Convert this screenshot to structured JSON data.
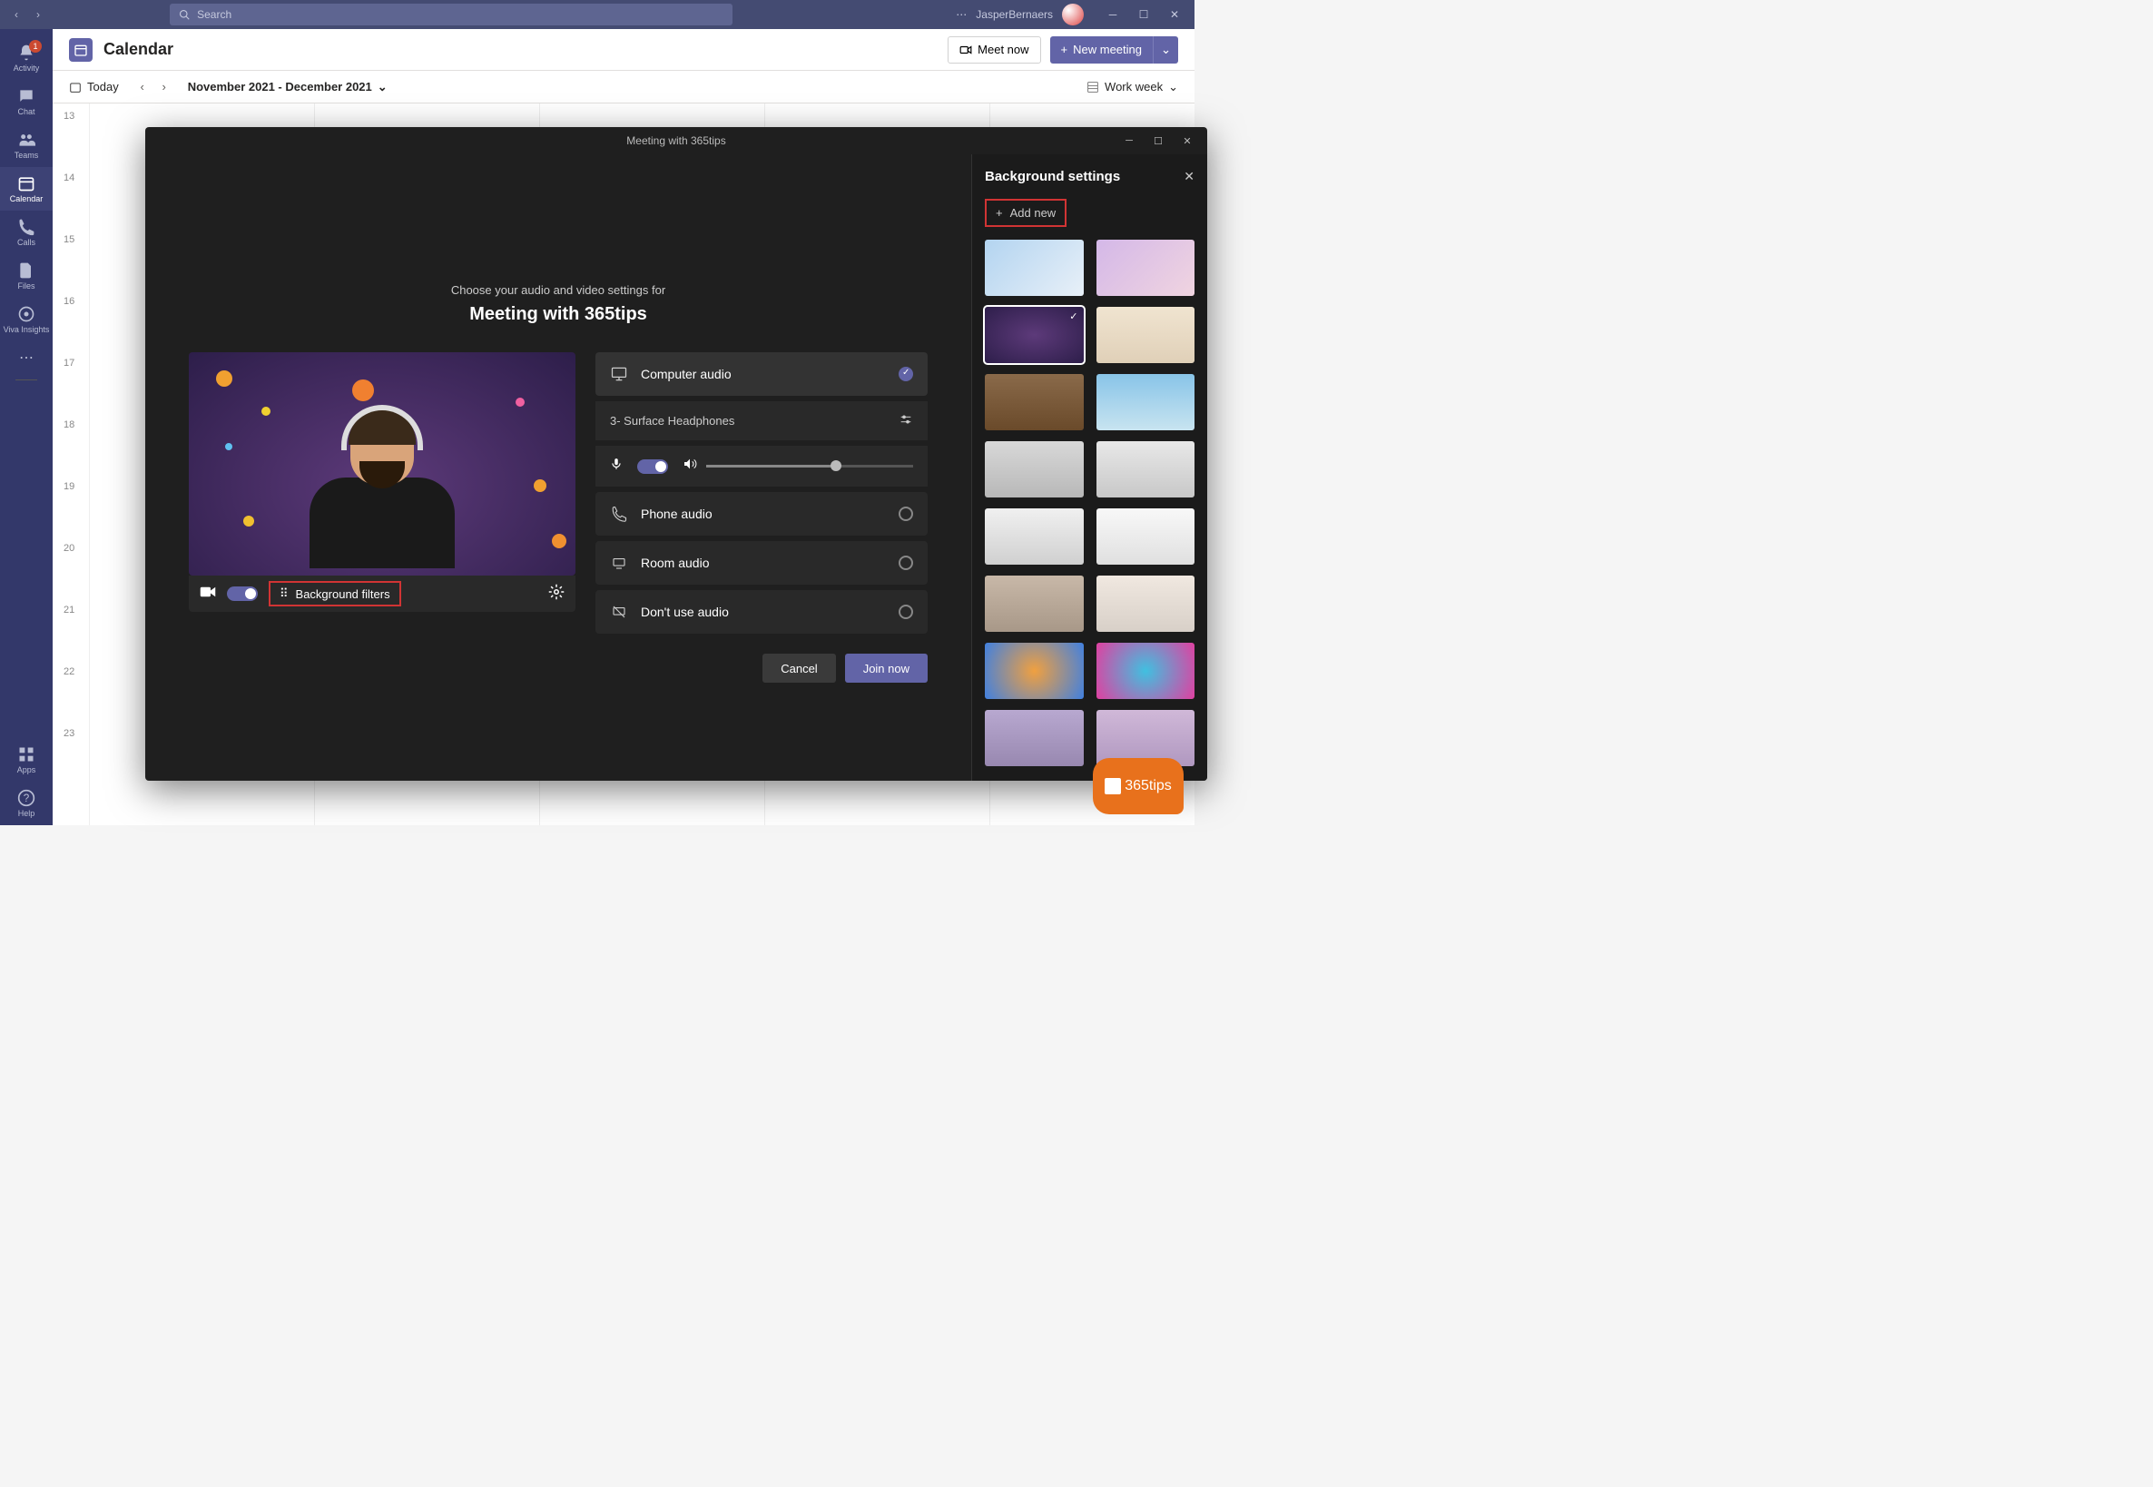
{
  "titlebar": {
    "search_placeholder": "Search",
    "username": "JasperBernaers"
  },
  "rail": {
    "items": [
      {
        "label": "Activity",
        "badge": "1"
      },
      {
        "label": "Chat"
      },
      {
        "label": "Teams"
      },
      {
        "label": "Calendar",
        "active": true
      },
      {
        "label": "Calls"
      },
      {
        "label": "Files"
      },
      {
        "label": "Viva Insights"
      }
    ],
    "apps_label": "Apps",
    "help_label": "Help"
  },
  "calendar": {
    "title": "Calendar",
    "meet_now": "Meet now",
    "new_meeting": "New meeting",
    "today": "Today",
    "range": "November 2021 - December 2021",
    "view": "Work week",
    "hours": [
      "13",
      "14",
      "15",
      "16",
      "17",
      "18",
      "19",
      "20",
      "21",
      "22",
      "23"
    ]
  },
  "modal": {
    "window_title": "Meeting with 365tips",
    "choose_text": "Choose your audio and video settings for",
    "meeting_name": "Meeting with 365tips",
    "bg_filters": "Background filters",
    "audio": {
      "computer": "Computer audio",
      "device": "3- Surface Headphones",
      "phone": "Phone audio",
      "room": "Room audio",
      "none": "Don't use audio"
    },
    "cancel": "Cancel",
    "join": "Join now"
  },
  "bg_panel": {
    "title": "Background settings",
    "add_new": "Add new",
    "thumbs": [
      {
        "bg": "linear-gradient(135deg,#b3d4f0,#e8f0f8)"
      },
      {
        "bg": "linear-gradient(135deg,#d4b8e8,#f0d4e0)"
      },
      {
        "bg": "radial-gradient(ellipse,#5d3a7a,#2d1e4a)",
        "selected": true
      },
      {
        "bg": "linear-gradient(#f0e4d0,#e0d0b8)"
      },
      {
        "bg": "linear-gradient(#8a6a4a,#6a4a2a)"
      },
      {
        "bg": "linear-gradient(#88c4e8,#c8e4f0)"
      },
      {
        "bg": "linear-gradient(#d8d8d8,#b8b8b8)"
      },
      {
        "bg": "linear-gradient(#e8e8e8,#c8c8c8)"
      },
      {
        "bg": "linear-gradient(#f0f0f0,#d0d0d0)"
      },
      {
        "bg": "linear-gradient(#f8f8f8,#e0e0e0)"
      },
      {
        "bg": "linear-gradient(#c8b8a8,#a89888)"
      },
      {
        "bg": "linear-gradient(#f0e8e0,#d8d0c8)"
      },
      {
        "bg": "radial-gradient(circle,#f0a040,#4080e0)"
      },
      {
        "bg": "radial-gradient(circle,#40c0e0,#e040a0)"
      },
      {
        "bg": "linear-gradient(#b8a8d0,#9888b0)"
      },
      {
        "bg": "linear-gradient(#d0b8d8,#b098c0)"
      }
    ]
  },
  "tips_badge": "365tips"
}
